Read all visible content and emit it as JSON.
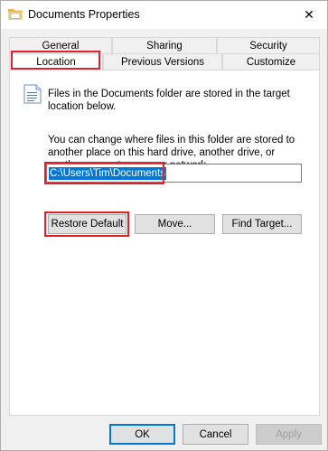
{
  "window": {
    "title": "Documents Properties",
    "close_glyph": "✕"
  },
  "tabs_row1": [
    "General",
    "Sharing",
    "Security"
  ],
  "tabs_row2": [
    "Location",
    "Previous Versions",
    "Customize"
  ],
  "location": {
    "info": "Files in the Documents folder are stored in the target location below.",
    "description": "You can change where files in this folder are stored to another place on this hard drive, another drive, or another computer on your network.",
    "path": "C:\\Users\\Tim\\Documents",
    "restore_default": "Restore Default",
    "move": "Move...",
    "find_target": "Find Target..."
  },
  "footer": {
    "ok": "OK",
    "cancel": "Cancel",
    "apply": "Apply"
  },
  "colors": {
    "highlight": "#e0202d",
    "selection": "#0078d7"
  }
}
